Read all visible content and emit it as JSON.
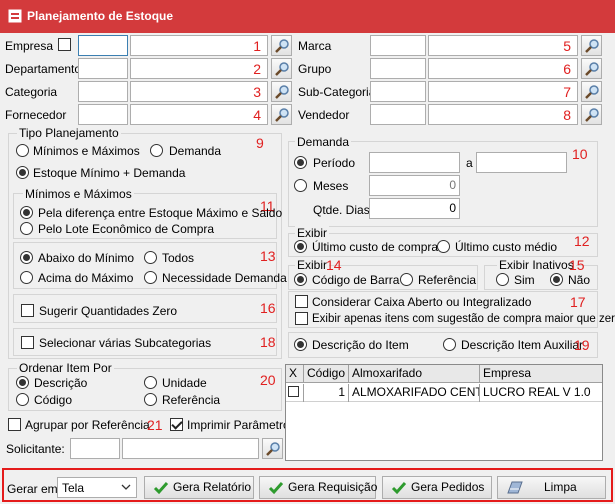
{
  "window": {
    "title": "Planejamento de Estoque"
  },
  "filters": {
    "empresa": {
      "label": "Empresa",
      "badge": "1"
    },
    "departamento": {
      "label": "Departamento",
      "badge": "2"
    },
    "categoria": {
      "label": "Categoria",
      "badge": "3"
    },
    "fornecedor": {
      "label": "Fornecedor",
      "badge": "4"
    },
    "marca": {
      "label": "Marca",
      "badge": "5"
    },
    "grupo": {
      "label": "Grupo",
      "badge": "6"
    },
    "subcategoria": {
      "label": "Sub-Categoria",
      "badge": "7"
    },
    "vendedor": {
      "label": "Vendedor",
      "badge": "8"
    }
  },
  "tipo_planejamento": {
    "title": "Tipo Planejamento",
    "badge": "9",
    "opt_min_max": "Mínimos e Máximos",
    "opt_demanda": "Demanda",
    "opt_estoque": "Estoque Mínimo + Demanda",
    "minmax_group": {
      "title": "Mínimos e Máximos",
      "badge": "11",
      "opt_diff": "Pela diferença entre Estoque Máximo e Saldo",
      "opt_lote": "Pelo Lote Econômico de Compra"
    },
    "faixa": {
      "badge": "13",
      "abaixo": "Abaixo do Mínimo",
      "todos": "Todos",
      "acima": "Acima do Máximo",
      "necessidade": "Necessidade Demanda"
    },
    "sugerir": {
      "label": "Sugerir Quantidades Zero",
      "badge": "16"
    },
    "varias_sub": {
      "label": "Selecionar várias Subcategorias",
      "badge": "18"
    }
  },
  "ordenar": {
    "title": "Ordenar Item Por",
    "badge": "20",
    "descricao": "Descrição",
    "unidade": "Unidade",
    "codigo": "Código",
    "referencia": "Referência"
  },
  "agrupar": {
    "label": "Agrupar por Referência",
    "badge": "21"
  },
  "imprimir": {
    "label": "Imprimir Parâmetros"
  },
  "solicitante": {
    "label": "Solicitante:"
  },
  "demanda": {
    "title": "Demanda",
    "badge": "10",
    "periodo": "Período",
    "a": "a",
    "meses": "Meses",
    "meses_value": "0",
    "qtde_label": "Qtde. Dias:",
    "qtde_value": "0"
  },
  "exibir": {
    "title": "Exibir",
    "badge": "12",
    "ultimo_custo": "Último custo de compra",
    "ultimo_medio": "Último custo médio"
  },
  "exibir2": {
    "title": "Exibir",
    "badge": "14",
    "codigo_barra": "Código de Barra",
    "referencia": "Referência"
  },
  "exibir_inativos": {
    "title": "Exibir Inativos",
    "badge": "15",
    "sim": "Sim",
    "nao": "Não"
  },
  "consideracoes": {
    "badge": "17",
    "caixa": "Considerar Caixa Aberto ou Integralizado",
    "sugestao": "Exibir apenas itens com sugestão de compra maior que zero"
  },
  "descricao_item": {
    "badge": "19",
    "opt_descricao": "Descrição do Item",
    "opt_auxiliar": "Descrição Item Auxiliar"
  },
  "almox_grid": {
    "headers": [
      "X",
      "Código",
      "Almoxarifado",
      "Empresa"
    ],
    "rows": [
      {
        "codigo": "1",
        "almoxarifado": "ALMOXARIFADO CENTRAL",
        "empresa": "LUCRO REAL V 1.0"
      }
    ]
  },
  "bottom": {
    "gerar_em_label": "Gerar em:",
    "gerar_em_value": "Tela",
    "btn_relatorio": "Gera Relatório",
    "btn_requisicao": "Gera Requisição",
    "btn_pedidos": "Gera Pedidos",
    "btn_limpa": "Limpa"
  },
  "colors": {
    "titlebar": "#d33a3c",
    "badge": "#e02020",
    "highlight_border": "#e41b1b"
  }
}
